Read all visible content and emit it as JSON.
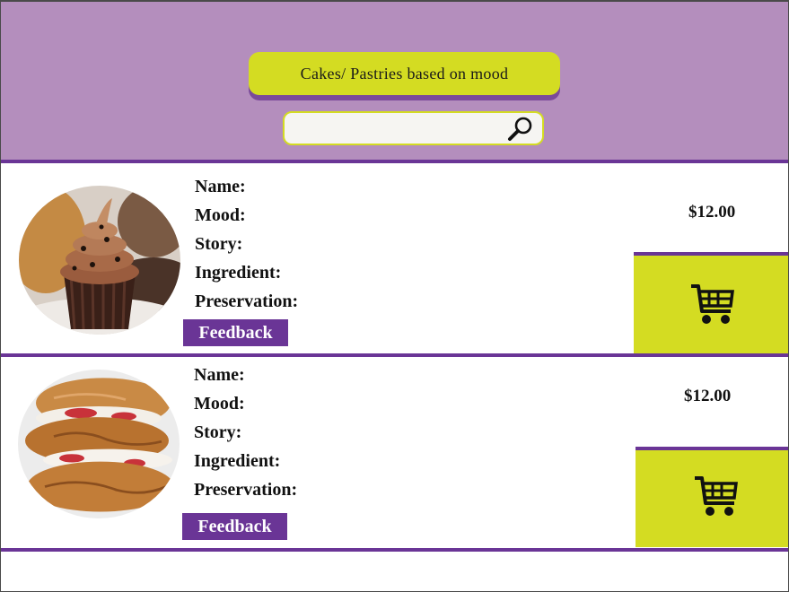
{
  "header": {
    "title": "Cakes/ Pastries based on mood",
    "search": {
      "value": "",
      "placeholder": ""
    }
  },
  "products": [
    {
      "image_subject": "chocolate-cupcake",
      "labels": {
        "name": "Name:",
        "mood": "Mood:",
        "story": "Story:",
        "ingredient": "Ingredient:",
        "preservation": "Preservation:"
      },
      "feedback_label": "Feedback",
      "price": "$12.00"
    },
    {
      "image_subject": "cream-puff-pastry",
      "labels": {
        "name": "Name:",
        "mood": "Mood:",
        "story": "Story:",
        "ingredient": "Ingredient:",
        "preservation": "Preservation:"
      },
      "feedback_label": "Feedback",
      "price": "$12.00"
    }
  ],
  "icons": {
    "search": "search-icon",
    "cart": "shopping-cart-icon"
  },
  "colors": {
    "header_bg": "#b48ebd",
    "accent_lime": "#d4dc22",
    "accent_purple": "#6a3596"
  }
}
